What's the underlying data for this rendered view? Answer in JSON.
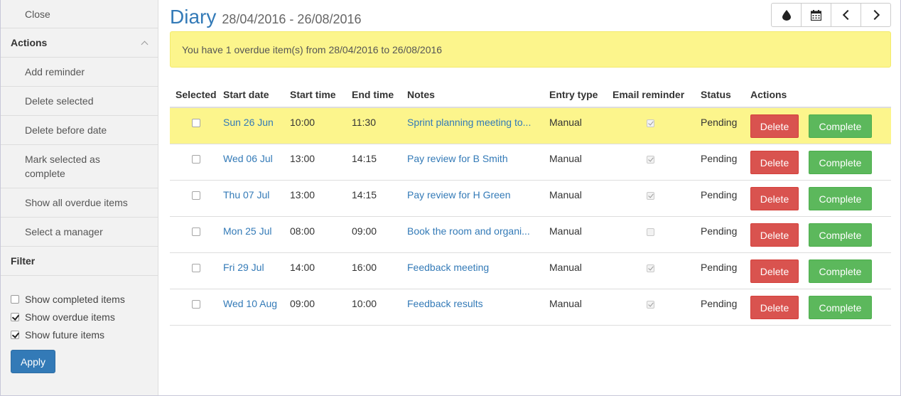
{
  "sidebar": {
    "close_label": "Close",
    "actions_header": "Actions",
    "actions": [
      {
        "label": "Add reminder"
      },
      {
        "label": "Delete selected"
      },
      {
        "label": "Delete before date"
      },
      {
        "label": "Mark selected as complete"
      },
      {
        "label": "Show all overdue items"
      },
      {
        "label": "Select a manager"
      }
    ],
    "filter_header": "Filter",
    "filters": [
      {
        "label": "Show completed items",
        "checked": false
      },
      {
        "label": "Show overdue items",
        "checked": true
      },
      {
        "label": "Show future items",
        "checked": true
      }
    ],
    "apply_label": "Apply"
  },
  "header": {
    "title": "Diary",
    "date_range": "28/04/2016 - 26/08/2016",
    "toolbar": [
      "drop-icon",
      "calendar-icon",
      "chevron-left-icon",
      "chevron-right-icon"
    ]
  },
  "alert": {
    "text": "You have 1 overdue item(s) from 28/04/2016 to 26/08/2016",
    "color": "#fcf58c"
  },
  "table": {
    "columns": [
      "Selected",
      "Start date",
      "Start time",
      "End time",
      "Notes",
      "Entry type",
      "Email reminder",
      "Status",
      "Actions"
    ],
    "delete_label": "Delete",
    "complete_label": "Complete",
    "rows": [
      {
        "start_date": "Sun 26 Jun",
        "start_time": "10:00",
        "end_time": "11:30",
        "notes": "Sprint planning meeting to...",
        "entry_type": "Manual",
        "email": true,
        "status": "Pending",
        "overdue": true
      },
      {
        "start_date": "Wed 06 Jul",
        "start_time": "13:00",
        "end_time": "14:15",
        "notes": "Pay review for B Smith",
        "entry_type": "Manual",
        "email": true,
        "status": "Pending",
        "overdue": false
      },
      {
        "start_date": "Thu 07 Jul",
        "start_time": "13:00",
        "end_time": "14:15",
        "notes": "Pay review for H Green",
        "entry_type": "Manual",
        "email": true,
        "status": "Pending",
        "overdue": false
      },
      {
        "start_date": "Mon 25 Jul",
        "start_time": "08:00",
        "end_time": "09:00",
        "notes": "Book the room and organi...",
        "entry_type": "Manual",
        "email": false,
        "status": "Pending",
        "overdue": false
      },
      {
        "start_date": "Fri 29 Jul",
        "start_time": "14:00",
        "end_time": "16:00",
        "notes": "Feedback meeting",
        "entry_type": "Manual",
        "email": true,
        "status": "Pending",
        "overdue": false
      },
      {
        "start_date": "Wed 10 Aug",
        "start_time": "09:00",
        "end_time": "10:00",
        "notes": "Feedback results",
        "entry_type": "Manual",
        "email": true,
        "status": "Pending",
        "overdue": false
      }
    ]
  }
}
